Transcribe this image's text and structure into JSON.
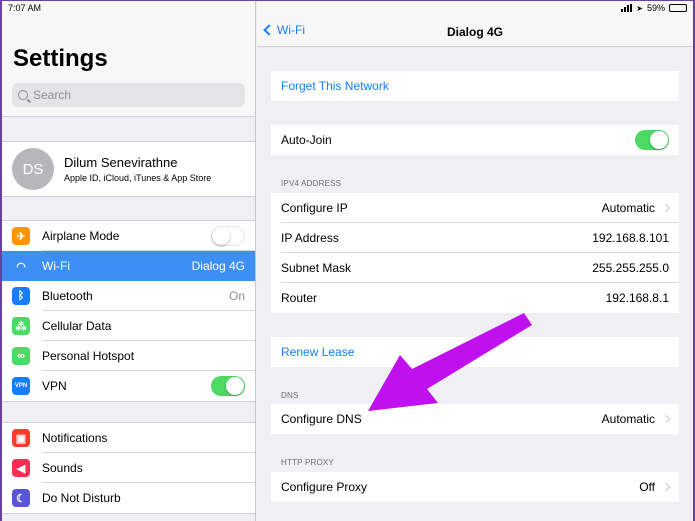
{
  "status": {
    "time": "7:07 AM",
    "battery": "59%",
    "battery_level": 0.59
  },
  "left": {
    "title": "Settings",
    "search_placeholder": "Search",
    "profile": {
      "initials": "DS",
      "name": "Dilum Senevirathne",
      "subtitle": "Apple ID, iCloud, iTunes & App Store"
    },
    "group1": [
      {
        "label": "Airplane Mode",
        "icon": "airplane-icon",
        "color": "#ff9500",
        "toggle": "off"
      },
      {
        "label": "Wi-Fi",
        "icon": "wifi-icon",
        "color": "#157efb",
        "value": "Dialog 4G",
        "selected": true
      },
      {
        "label": "Bluetooth",
        "icon": "bluetooth-icon",
        "color": "#157efb",
        "value": "On"
      },
      {
        "label": "Cellular Data",
        "icon": "cellular-icon",
        "color": "#4cd964"
      },
      {
        "label": "Personal Hotspot",
        "icon": "hotspot-icon",
        "color": "#4cd964"
      },
      {
        "label": "VPN",
        "icon": "vpn-icon",
        "color": "#157efb",
        "badge": "VPN",
        "toggle": "on"
      }
    ],
    "group2": [
      {
        "label": "Notifications",
        "icon": "notifications-icon",
        "color": "#ff3b30"
      },
      {
        "label": "Sounds",
        "icon": "sounds-icon",
        "color": "#ff2d55"
      },
      {
        "label": "Do Not Disturb",
        "icon": "moon-icon",
        "color": "#5856d6"
      }
    ]
  },
  "right": {
    "back_label": "Wi-Fi",
    "nav_title": "Dialog 4G",
    "forget": "Forget This Network",
    "auto_join": "Auto-Join",
    "ipv4_header": "IPV4 ADDRESS",
    "ipv4": [
      {
        "label": "Configure IP",
        "value": "Automatic",
        "chevron": true
      },
      {
        "label": "IP Address",
        "value": "192.168.8.101"
      },
      {
        "label": "Subnet Mask",
        "value": "255.255.255.0"
      },
      {
        "label": "Router",
        "value": "192.168.8.1"
      }
    ],
    "renew": "Renew Lease",
    "dns_header": "DNS",
    "configure_dns": {
      "label": "Configure DNS",
      "value": "Automatic"
    },
    "proxy_header": "HTTP PROXY",
    "configure_proxy": {
      "label": "Configure Proxy",
      "value": "Off"
    }
  },
  "colors": {
    "accent": "#157efb",
    "toggle_on": "#4cd964",
    "selected_row": "#3d8ff5",
    "annotation_arrow": "#c010f0"
  }
}
